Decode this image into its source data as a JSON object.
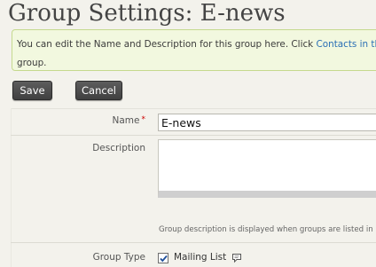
{
  "page": {
    "title": "Group Settings: E-news"
  },
  "notice": {
    "text_before": "You can edit the Name and Description for this group here. Click ",
    "link": "Contacts in this",
    "text_after": "group."
  },
  "toolbar": {
    "save_label": "Save",
    "cancel_label": "Cancel"
  },
  "form": {
    "name": {
      "label": "Name",
      "required_marker": "*",
      "value": "E-news"
    },
    "description": {
      "label": "Description",
      "value": "",
      "help": "Group description is displayed when groups are listed in P"
    },
    "group_type": {
      "label": "Group Type",
      "options": [
        {
          "label": "Mailing List",
          "checked": true
        }
      ],
      "icon": "comment-icon"
    }
  },
  "colors": {
    "notice_bg": "#f2f8df",
    "notice_border": "#c5d98e",
    "link": "#2a6fb5",
    "required": "#cc0000",
    "button_bg": "#4a4a4a"
  }
}
